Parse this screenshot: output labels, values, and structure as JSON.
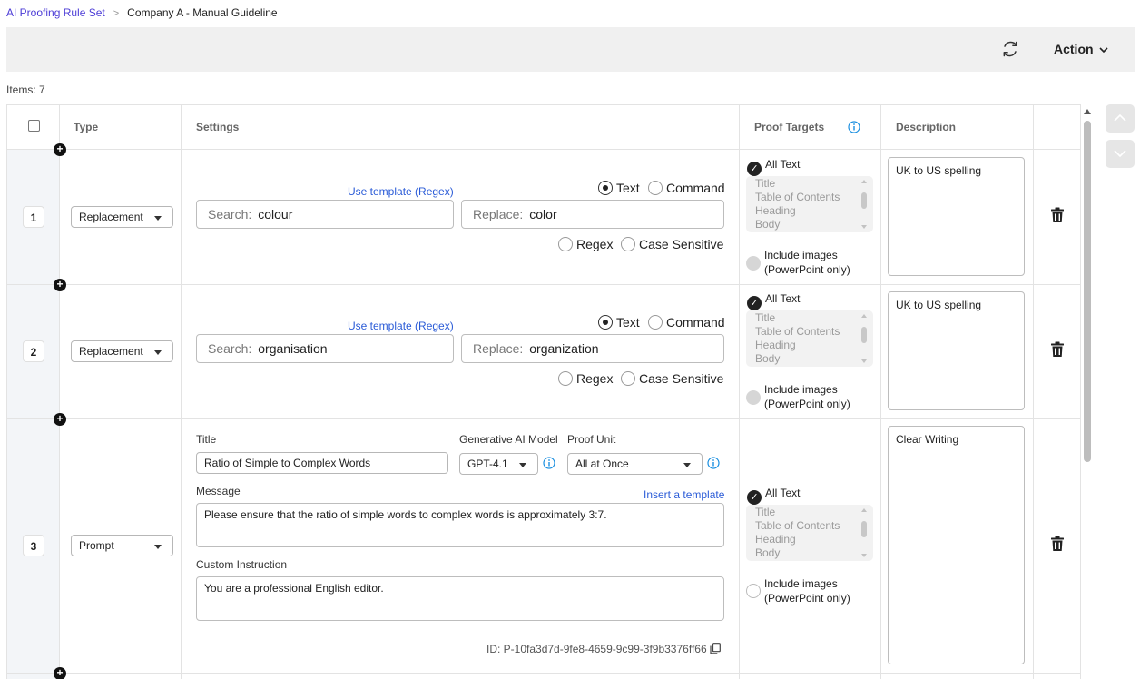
{
  "breadcrumb": {
    "parent": "AI Proofing Rule Set",
    "current": "Company A - Manual Guideline"
  },
  "toolbar": {
    "action_label": "Action",
    "refresh_icon": "refresh-icon"
  },
  "items_count": "Items: 7",
  "columns": {
    "type": "Type",
    "settings": "Settings",
    "proof_targets": "Proof Targets",
    "description": "Description"
  },
  "target_list": [
    "Title",
    "Table of Contents",
    "Heading",
    "Body"
  ],
  "labels": {
    "use_template": "Use template (Regex)",
    "text": "Text",
    "command": "Command",
    "regex": "Regex",
    "case_sensitive": "Case Sensitive",
    "search_ph": "Search:",
    "replace_ph": "Replace:",
    "all_text": "All Text",
    "include_images_1": "Include images",
    "include_images_2": "(PowerPoint only)",
    "title": "Title",
    "gen_model": "Generative AI Model",
    "proof_unit": "Proof Unit",
    "message": "Message",
    "insert_template": "Insert a template",
    "custom_instruction": "Custom Instruction"
  },
  "rows": [
    {
      "num": "1",
      "type": "Replacement",
      "search": "colour",
      "replace": "color",
      "description": "UK to US spelling"
    },
    {
      "num": "2",
      "type": "Replacement",
      "search": "organisation",
      "replace": "organization",
      "description": "UK to US spelling"
    },
    {
      "num": "3",
      "type": "Prompt",
      "title_value": "Ratio of Simple to Complex Words",
      "model": "GPT-4.1",
      "proof_unit": "All at Once",
      "message": "Please ensure that the ratio of simple words to complex words is approximately 3:7.",
      "custom_instruction": "You are a professional English editor.",
      "id": "ID: P-10fa3d7d-9fe8-4659-9c99-3f9b3376ff66",
      "description": "Clear Writing"
    }
  ],
  "colors": {
    "link": "#2a5bd7",
    "breadcrumb_link": "#4b3bd6",
    "number_column": "#f3f5f8",
    "toolbar": "#f0f0f0"
  }
}
